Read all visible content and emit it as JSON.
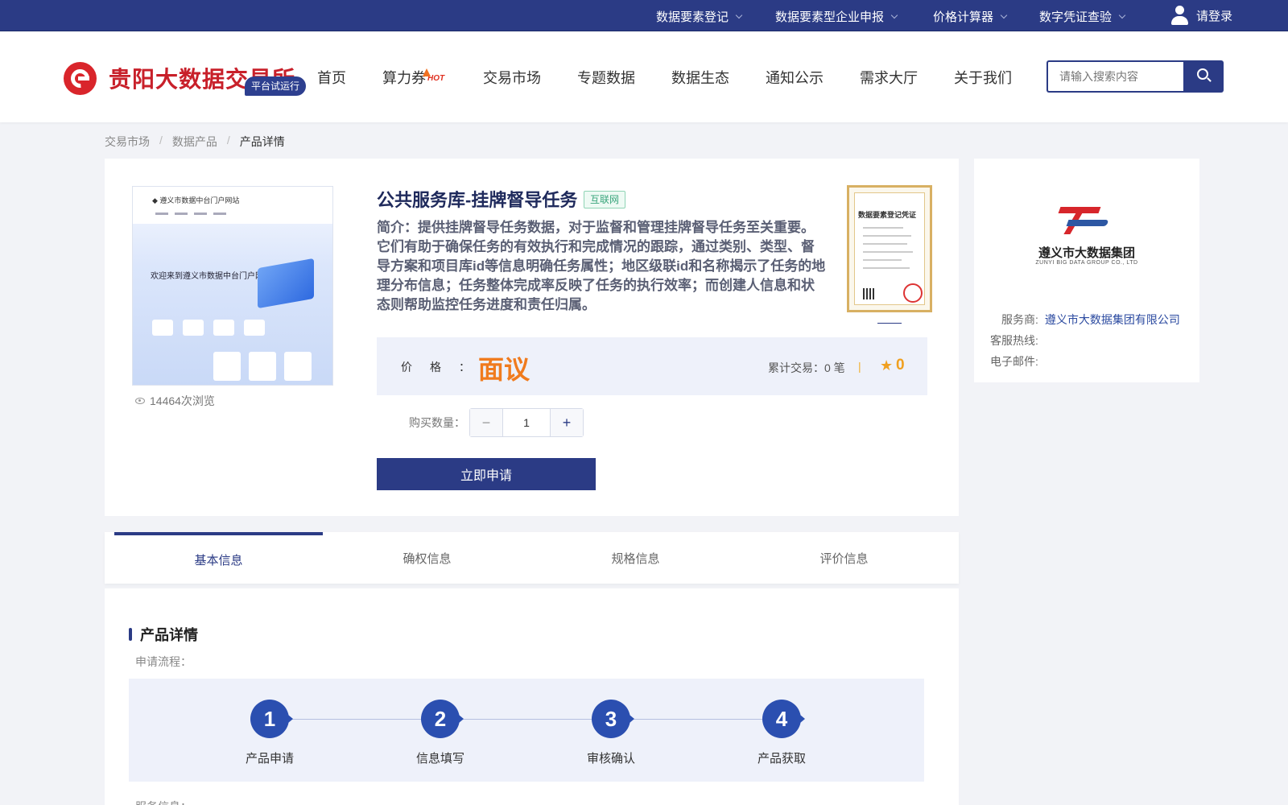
{
  "topbar": {
    "links": [
      "数据要素登记",
      "数据要素型企业申报",
      "价格计算器",
      "数字凭证查验"
    ],
    "login": "请登录"
  },
  "header": {
    "logo_text": "贵阳大数据交易所",
    "trial_badge": "平台试运行",
    "nav": [
      "首页",
      "算力券",
      "交易市场",
      "专题数据",
      "数据生态",
      "通知公示",
      "需求大厅",
      "关于我们"
    ],
    "hot_badge": "HOT",
    "search_placeholder": "请输入搜索内容"
  },
  "breadcrumb": [
    "交易市场",
    "数据产品",
    "产品详情"
  ],
  "product": {
    "title": "公共服务库-挂牌督导任务",
    "tag": "互联网",
    "description": "简介：提供挂牌督导任务数据，对于监督和管理挂牌督导任务至关重要。它们有助于确保任务的有效执行和完成情况的跟踪，通过类别、类型、督导方案和项目库id等信息明确任务属性；地区级联id和名称揭示了任务的地理分布信息；任务整体完成率反映了任务的执行效率；而创建人信息和状态则帮助监控任务进度和责任归属。",
    "views": "14464次浏览",
    "thumbnail_title": "欢迎来到遵义市数据中台门户网站",
    "certificate_title": "数据要素登记凭证",
    "price_label": "价格：",
    "price_value": "面议",
    "trades": "累计交易：0 笔",
    "rating": "0",
    "qty_label": "购买数量：",
    "qty_value": "1",
    "apply_button": "立即申请"
  },
  "provider": {
    "logo_cn": "遵义市大数据集团",
    "logo_en": "ZUNYI BIG DATA GROUP CO., LTD",
    "service_label": "服务商:",
    "service_value": "遵义市大数据集团有限公司",
    "hotline_label": "客服热线:",
    "email_label": "电子邮件:"
  },
  "tabs": [
    "基本信息",
    "确权信息",
    "规格信息",
    "评价信息"
  ],
  "detail": {
    "section_title": "产品详情",
    "flow_label": "申请流程：",
    "steps": [
      {
        "num": "1",
        "label": "产品申请"
      },
      {
        "num": "2",
        "label": "信息填写"
      },
      {
        "num": "3",
        "label": "审核确认"
      },
      {
        "num": "4",
        "label": "产品获取"
      }
    ],
    "service_info_label": "服务信息："
  },
  "colors": {
    "primary": "#2b3b85",
    "brand_red": "#c8202a",
    "price_orange": "#f07b1e"
  }
}
